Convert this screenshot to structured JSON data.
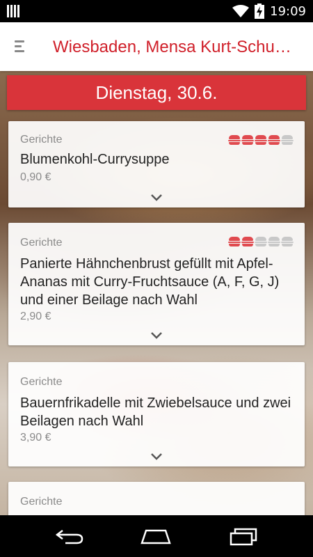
{
  "status_bar": {
    "time": "19:09",
    "icons": [
      "signal-bars-icon",
      "wifi-icon",
      "battery-charging-icon"
    ]
  },
  "app_bar": {
    "menu_icon": "hamburger-menu-icon",
    "title": "Wiesbaden, Mensa Kurt-Schu…"
  },
  "day": "Dienstag, 30.6.",
  "colors": {
    "accent_red": "#d0202a",
    "banner_red": "#d9343a",
    "rating_filled": "#e04a4f",
    "rating_empty": "#c8c8c8"
  },
  "meals": [
    {
      "category": "Gerichte",
      "name": "Blumenkohl-Currysuppe",
      "price": "0,90 €",
      "rating": 4,
      "rating_max": 5,
      "expand_icon": "chevron-down-icon"
    },
    {
      "category": "Gerichte",
      "name": "Panierte Hähnchenbrust gefüllt mit Apfel-Ananas mit Curry-Fruchtsauce (A, F, G, J) und einer Beilage nach Wahl",
      "price": "2,90 €",
      "rating": 2,
      "rating_max": 5,
      "expand_icon": "chevron-down-icon"
    },
    {
      "category": "Gerichte",
      "name": "Bauernfrikadelle mit Zwiebelsauce und zwei Beilagen nach Wahl",
      "price": "3,90 €",
      "rating": 0,
      "rating_max": 5,
      "expand_icon": "chevron-down-icon"
    },
    {
      "category": "Gerichte",
      "name": "",
      "price": "",
      "rating": 0,
      "rating_max": 5,
      "expand_icon": "chevron-down-icon"
    }
  ],
  "nav_bar": {
    "buttons": [
      "back-icon",
      "home-icon",
      "recents-icon"
    ]
  }
}
